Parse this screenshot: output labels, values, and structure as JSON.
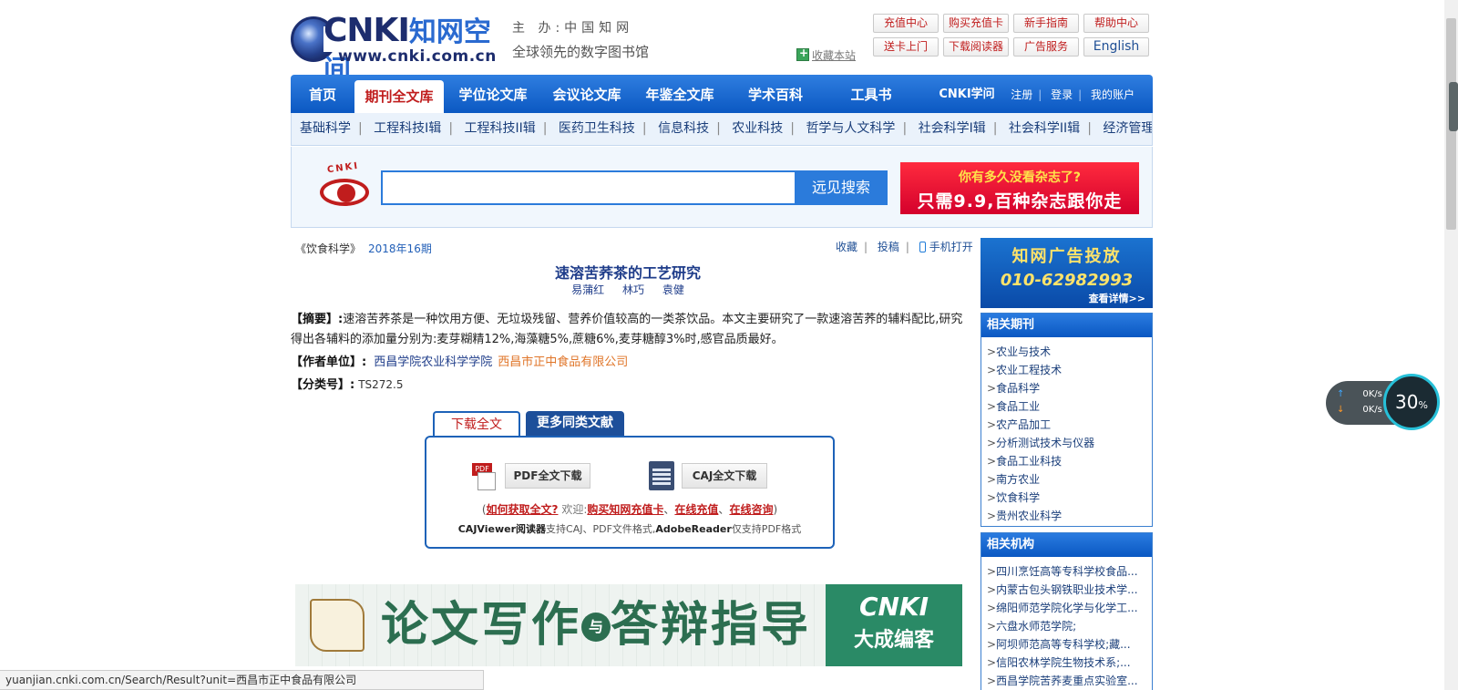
{
  "header": {
    "logo_text": "CNKI",
    "logo_cn": "知网空间",
    "logo_url": "www.cnki.com.cn",
    "sponsor": "主 办:中国知网",
    "tagline": "全球领先的数字图书馆",
    "favorite": "收藏本站",
    "top_buttons": [
      "充值中心",
      "购买充值卡",
      "新手指南",
      "帮助中心",
      "送卡上门",
      "下载阅读器",
      "广告服务",
      "English"
    ]
  },
  "nav": {
    "items": [
      "首页",
      "期刊全文库",
      "学位论文库",
      "会议论文库",
      "年鉴全文库",
      "学术百科",
      "工具书",
      "CNKI学问"
    ],
    "active": "期刊全文库",
    "user_links": [
      "注册",
      "登录",
      "我的账户"
    ]
  },
  "subnav": [
    "基础科学",
    "工程科技I辑",
    "工程科技II辑",
    "医药卫生科技",
    "信息科技",
    "农业科技",
    "哲学与人文科学",
    "社会科学I辑",
    "社会科学II辑",
    "经济管理"
  ],
  "search": {
    "eye_label": "CNKI",
    "input_value": "",
    "button": "远见搜索",
    "promo_line1": "你有多久没看杂志了?",
    "promo_line2": "只需9.9,百种杂志跟你走"
  },
  "article": {
    "journal": "《饮食科学》",
    "issue": "2018年16期",
    "actions": [
      "收藏",
      "投稿",
      "手机打开"
    ],
    "title": "速溶苦荞茶的工艺研究",
    "authors": [
      "易蒲红",
      "林巧",
      "袁健"
    ],
    "abstract_label": "【摘要】:",
    "abstract": "速溶苦荞茶是一种饮用方便、无垃圾残留、营养价值较高的一类茶饮品。本文主要研究了一款速溶苦荞的辅料配比,研究得出各辅料的添加量分别为:麦芽糊精12%,海藻糖5%,蔗糖6%,麦芽糖醇3%时,感官品质最好。",
    "unit_label": "【作者单位】:",
    "units": [
      "西昌学院农业科学学院",
      "西昌市正中食品有限公司"
    ],
    "clc_label": "【分类号】:",
    "clc": "TS272.5"
  },
  "download": {
    "tabs": [
      "下载全文",
      "更多同类文献"
    ],
    "pdf_button": "PDF全文下载",
    "caj_button": "CAJ全文下载",
    "help_open": "(",
    "how_to": "如何获取全文?",
    "welcome": "欢迎:",
    "buy": "购买知网充值卡",
    "sep1": "、",
    "online_pay": "在线充值",
    "sep2": "、",
    "online_consult": "在线咨询",
    "help_close": ")",
    "note_caj": "CAJViewer阅读器",
    "note_mid": "支持CAJ、PDF文件格式,",
    "note_adobe": "AdobeReader",
    "note_end": "仅支持PDF格式"
  },
  "bottom_banner": {
    "text1": "论文写作",
    "yu": "与",
    "text2": "答辩指导",
    "brand": "CNKI",
    "brand_sub": "大成编客"
  },
  "sidebar": {
    "ad_line1": "知网广告投放",
    "ad_line2": "010-62982993",
    "ad_more": "查看详情>>",
    "journals_title": "相关期刊",
    "journals": [
      "农业与技术",
      "农业工程技术",
      "食品科学",
      "食品工业",
      "农产品加工",
      "分析测试技术与仪器",
      "食品工业科技",
      "南方农业",
      "饮食科学",
      "贵州农业科学"
    ],
    "orgs_title": "相关机构",
    "orgs": [
      "四川烹饪高等专科学校食品...",
      "内蒙古包头钢铁职业技术学...",
      "绵阳师范学院化学与化学工...",
      "六盘水师范学院;",
      "阿坝师范高等专科学校;藏...",
      "信阳农林学院生物技术系;...",
      "西昌学院苦荞麦重点实验室..."
    ]
  },
  "status_bar": "yuanjian.cnki.com.cn/Search/Result?unit=西昌市正中食品有限公司",
  "speed_widget": {
    "up": "0K/s",
    "down": "0K/s",
    "percent": "30",
    "percent_sign": "%"
  }
}
